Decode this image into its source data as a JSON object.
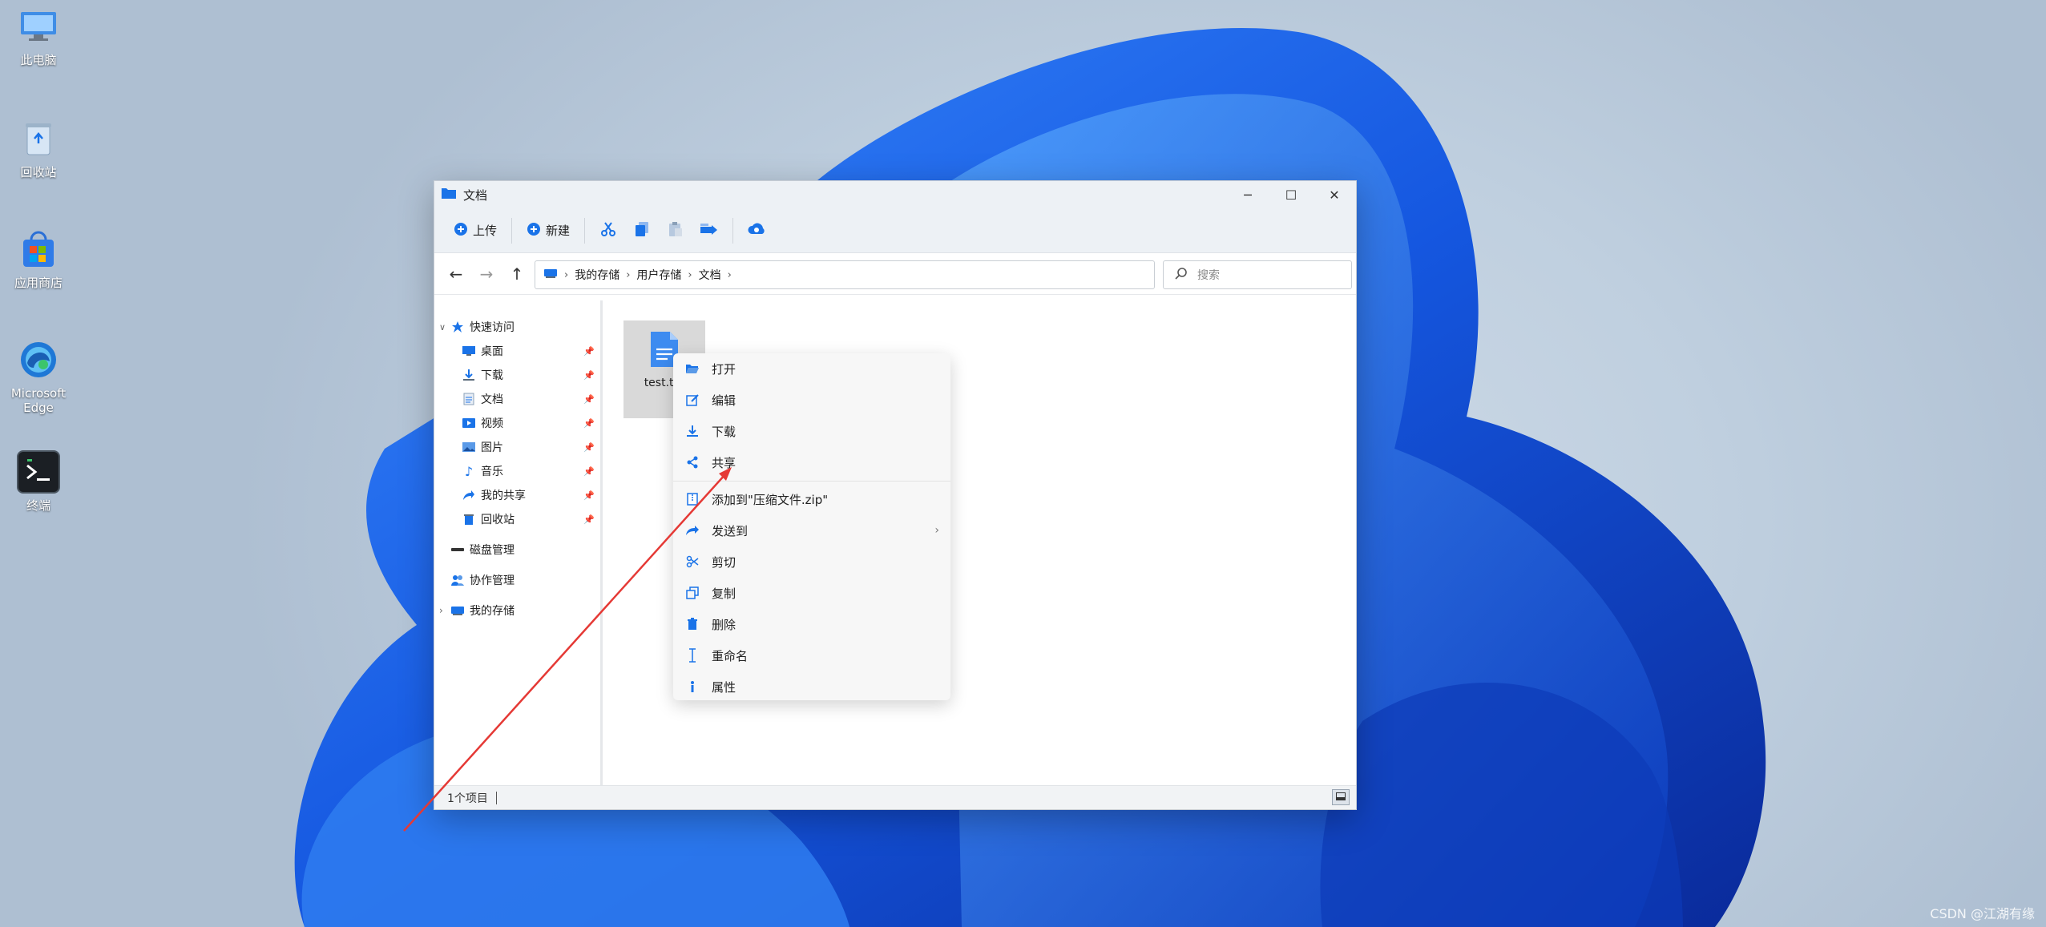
{
  "desktop": {
    "icons": [
      {
        "label": "此电脑"
      },
      {
        "label": "回收站"
      },
      {
        "label": "应用商店"
      },
      {
        "label": "Microsoft Edge"
      },
      {
        "label": "终端"
      }
    ]
  },
  "window": {
    "title": "文档",
    "toolbar": {
      "upload_label": "上传",
      "new_label": "新建"
    },
    "breadcrumb": [
      "我的存储",
      "用户存储",
      "文档"
    ],
    "search_placeholder": "搜索",
    "sidebar": {
      "quick_access": "快速访问",
      "items": [
        "桌面",
        "下载",
        "文档",
        "视频",
        "图片",
        "音乐",
        "我的共享",
        "回收站"
      ],
      "disk_management": "磁盘管理",
      "collab_management": "协作管理",
      "my_storage": "我的存储"
    },
    "files": [
      {
        "name": "test.txt"
      }
    ],
    "status": "1个项目"
  },
  "context_menu": {
    "items": [
      "打开",
      "编辑",
      "下载",
      "共享",
      "添加到\"压缩文件.zip\"",
      "发送到",
      "剪切",
      "复制",
      "删除",
      "重命名",
      "属性"
    ]
  },
  "watermark": "CSDN @江湖有缘",
  "colors": {
    "accent": "#1a73e8",
    "arrow": "#e53935"
  }
}
